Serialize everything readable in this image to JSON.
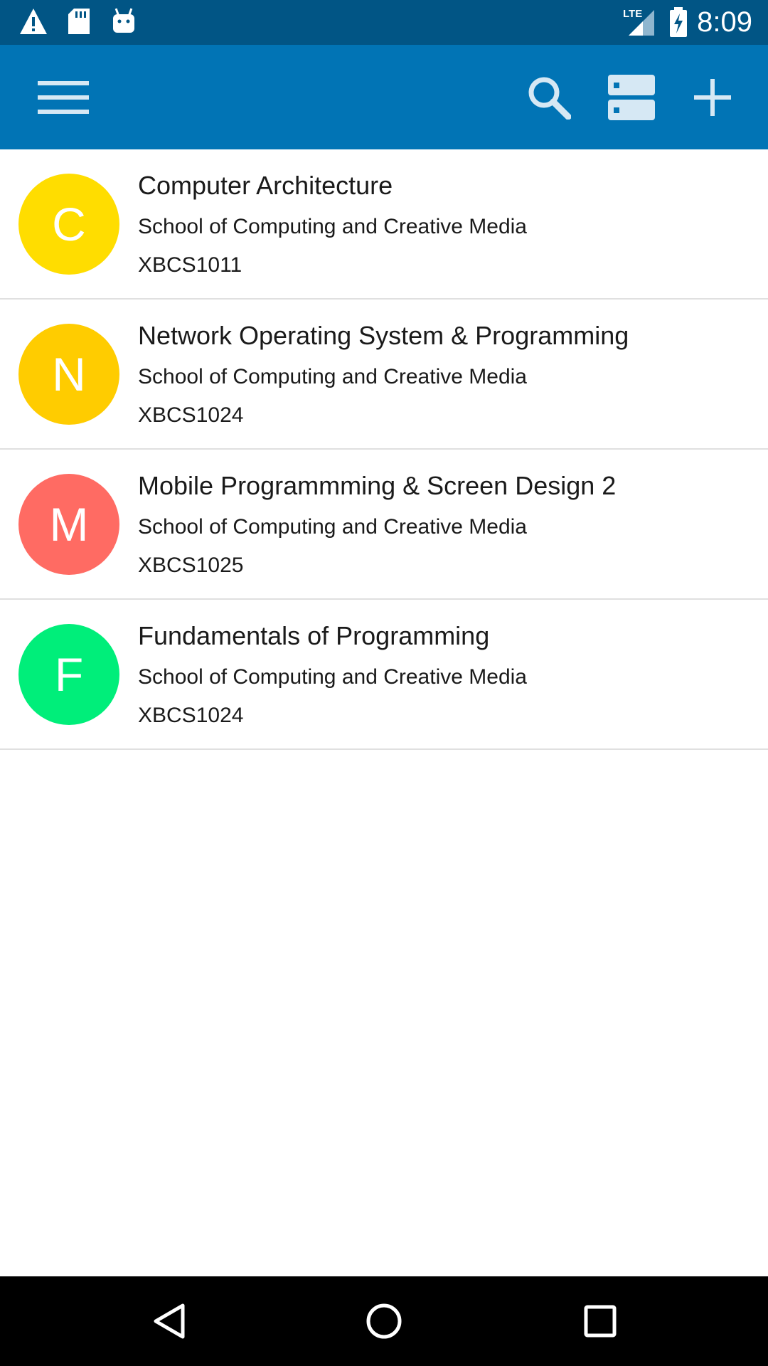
{
  "status_bar": {
    "time": "8:09",
    "network": "LTE",
    "left_icons": [
      "warning-icon",
      "sd-card-icon",
      "android-icon"
    ]
  },
  "toolbar": {
    "icons": [
      "menu-icon",
      "search-icon",
      "storage-icon",
      "add-icon"
    ],
    "color": "#0174b5"
  },
  "courses": [
    {
      "initial": "C",
      "title": "Computer Architecture",
      "school": "School of Computing and Creative Media",
      "code": "XBCS1011",
      "color": "#ffdd00"
    },
    {
      "initial": "N",
      "title": "Network Operating System & Programming",
      "school": "School of Computing and Creative Media",
      "code": "XBCS1024",
      "color": "#ffcc00"
    },
    {
      "initial": "M",
      "title": "Mobile Programmming & Screen Design 2",
      "school": "School of Computing and Creative Media",
      "code": "XBCS1025",
      "color": "#ff6b63"
    },
    {
      "initial": "F",
      "title": "Fundamentals of Programming",
      "school": "School of Computing and Creative Media",
      "code": "XBCS1024",
      "color": "#00ee7a"
    }
  ],
  "nav_bar": {
    "icons": [
      "back-icon",
      "home-icon",
      "recents-icon"
    ]
  }
}
